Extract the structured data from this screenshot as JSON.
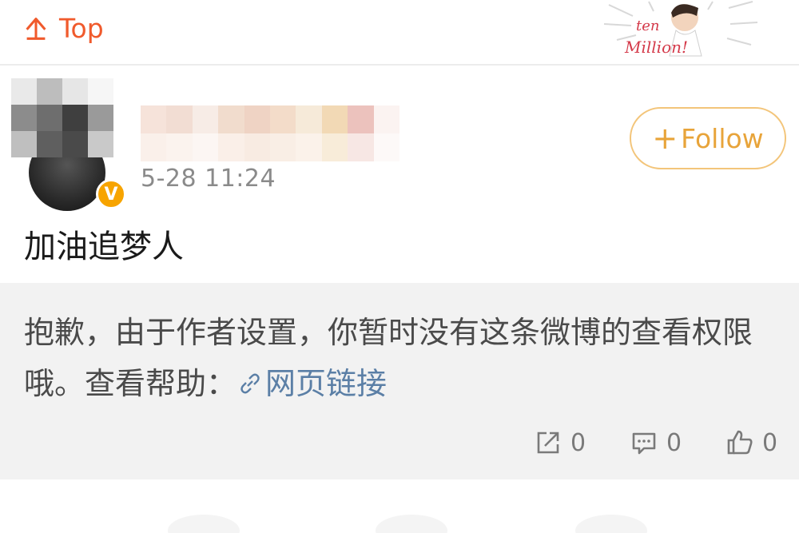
{
  "topbar": {
    "top_label": "Top",
    "badge_text_1": "ten",
    "badge_text_2": "Million!"
  },
  "post": {
    "timestamp": "5-28 11:24",
    "follow_label": "Follow",
    "content": "加油追梦人",
    "notice": {
      "text": "抱歉，由于作者设置，你暂时没有这条微博的查看权限哦。查看帮助：",
      "link_label": "网页链接"
    },
    "actions": {
      "share_count": "0",
      "comment_count": "0",
      "like_count": "0"
    }
  },
  "colors": {
    "accent_orange": "#f05a2c",
    "follow_gold": "#e8a43a",
    "link_blue": "#5b7fa6",
    "verified_badge": "#f7a400"
  }
}
